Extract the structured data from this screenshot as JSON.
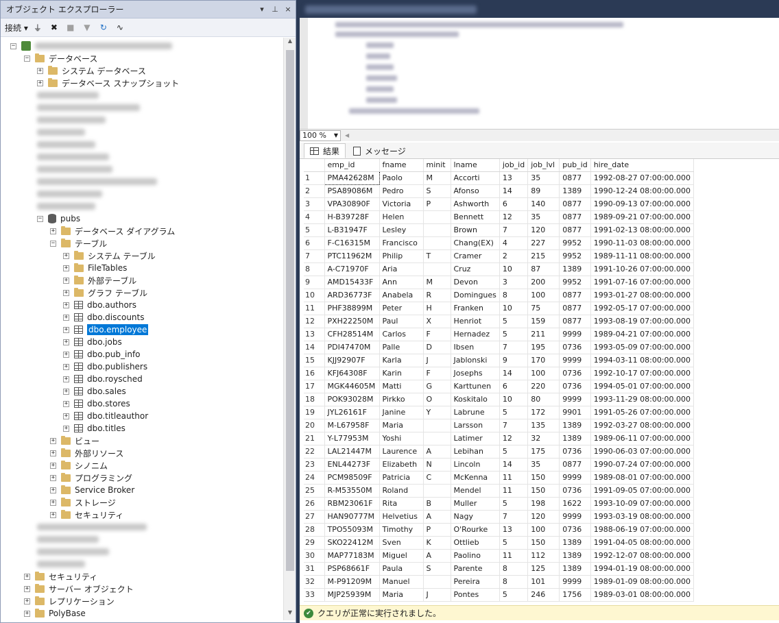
{
  "object_explorer": {
    "title": "オブジェクト エクスプローラー",
    "title_buttons": [
      "▾",
      "⊥",
      "×"
    ],
    "toolbar": {
      "connect": "接続 ▾"
    },
    "tree": [
      {
        "label": "データベース",
        "level": 1,
        "icon": "folder",
        "expander": "−"
      },
      {
        "label": "システム データベース",
        "level": 2,
        "icon": "folder",
        "expander": "+"
      },
      {
        "label": "データベース スナップショット",
        "level": 2,
        "icon": "folder",
        "expander": "+"
      },
      {
        "label": "pubs",
        "level": 2,
        "icon": "database",
        "expander": "−"
      },
      {
        "label": "データベース ダイアグラム",
        "level": 3,
        "icon": "folder",
        "expander": "+"
      },
      {
        "label": "テーブル",
        "level": 3,
        "icon": "folder",
        "expander": "−"
      },
      {
        "label": "システム テーブル",
        "level": 4,
        "icon": "folder",
        "expander": "+"
      },
      {
        "label": "FileTables",
        "level": 4,
        "icon": "folder",
        "expander": "+"
      },
      {
        "label": "外部テーブル",
        "level": 4,
        "icon": "folder",
        "expander": "+"
      },
      {
        "label": "グラフ テーブル",
        "level": 4,
        "icon": "folder",
        "expander": "+"
      },
      {
        "label": "dbo.authors",
        "level": 4,
        "icon": "table",
        "expander": "+"
      },
      {
        "label": "dbo.discounts",
        "level": 4,
        "icon": "table",
        "expander": "+"
      },
      {
        "label": "dbo.employee",
        "level": 4,
        "icon": "table",
        "expander": "+",
        "selected": true
      },
      {
        "label": "dbo.jobs",
        "level": 4,
        "icon": "table",
        "expander": "+"
      },
      {
        "label": "dbo.pub_info",
        "level": 4,
        "icon": "table",
        "expander": "+"
      },
      {
        "label": "dbo.publishers",
        "level": 4,
        "icon": "table",
        "expander": "+"
      },
      {
        "label": "dbo.roysched",
        "level": 4,
        "icon": "table",
        "expander": "+"
      },
      {
        "label": "dbo.sales",
        "level": 4,
        "icon": "table",
        "expander": "+"
      },
      {
        "label": "dbo.stores",
        "level": 4,
        "icon": "table",
        "expander": "+"
      },
      {
        "label": "dbo.titleauthor",
        "level": 4,
        "icon": "table",
        "expander": "+"
      },
      {
        "label": "dbo.titles",
        "level": 4,
        "icon": "table",
        "expander": "+"
      },
      {
        "label": "ビュー",
        "level": 3,
        "icon": "folder",
        "expander": "+"
      },
      {
        "label": "外部リソース",
        "level": 3,
        "icon": "folder",
        "expander": "+"
      },
      {
        "label": "シノニム",
        "level": 3,
        "icon": "folder",
        "expander": "+"
      },
      {
        "label": "プログラミング",
        "level": 3,
        "icon": "folder",
        "expander": "+"
      },
      {
        "label": "Service Broker",
        "level": 3,
        "icon": "folder",
        "expander": "+"
      },
      {
        "label": "ストレージ",
        "level": 3,
        "icon": "folder",
        "expander": "+"
      },
      {
        "label": "セキュリティ",
        "level": 3,
        "icon": "folder",
        "expander": "+"
      },
      {
        "label": "セキュリティ",
        "level": 1,
        "icon": "folder",
        "expander": "+"
      },
      {
        "label": "サーバー オブジェクト",
        "level": 1,
        "icon": "folder",
        "expander": "+"
      },
      {
        "label": "レプリケーション",
        "level": 1,
        "icon": "folder",
        "expander": "+"
      },
      {
        "label": "PolyBase",
        "level": 1,
        "icon": "folder",
        "expander": "+"
      }
    ]
  },
  "query": {
    "zoom": "100 %",
    "tabs": {
      "results": "結果",
      "messages": "メッセージ"
    },
    "status": "クエリが正常に実行されました。"
  },
  "results": {
    "columns": [
      "emp_id",
      "fname",
      "minit",
      "lname",
      "job_id",
      "job_lvl",
      "pub_id",
      "hire_date"
    ],
    "rows": [
      [
        "1",
        "PMA42628M",
        "Paolo",
        "M",
        "Accorti",
        "13",
        "35",
        "0877",
        "1992-08-27 07:00:00.000"
      ],
      [
        "2",
        "PSA89086M",
        "Pedro",
        "S",
        "Afonso",
        "14",
        "89",
        "1389",
        "1990-12-24 08:00:00.000"
      ],
      [
        "3",
        "VPA30890F",
        "Victoria",
        "P",
        "Ashworth",
        "6",
        "140",
        "0877",
        "1990-09-13 07:00:00.000"
      ],
      [
        "4",
        "H-B39728F",
        "Helen",
        "",
        "Bennett",
        "12",
        "35",
        "0877",
        "1989-09-21 07:00:00.000"
      ],
      [
        "5",
        "L-B31947F",
        "Lesley",
        "",
        "Brown",
        "7",
        "120",
        "0877",
        "1991-02-13 08:00:00.000"
      ],
      [
        "6",
        "F-C16315M",
        "Francisco",
        "",
        "Chang(EX)",
        "4",
        "227",
        "9952",
        "1990-11-03 08:00:00.000"
      ],
      [
        "7",
        "PTC11962M",
        "Philip",
        "T",
        "Cramer",
        "2",
        "215",
        "9952",
        "1989-11-11 08:00:00.000"
      ],
      [
        "8",
        "A-C71970F",
        "Aria",
        "",
        "Cruz",
        "10",
        "87",
        "1389",
        "1991-10-26 07:00:00.000"
      ],
      [
        "9",
        "AMD15433F",
        "Ann",
        "M",
        "Devon",
        "3",
        "200",
        "9952",
        "1991-07-16 07:00:00.000"
      ],
      [
        "10",
        "ARD36773F",
        "Anabela",
        "R",
        "Domingues",
        "8",
        "100",
        "0877",
        "1993-01-27 08:00:00.000"
      ],
      [
        "11",
        "PHF38899M",
        "Peter",
        "H",
        "Franken",
        "10",
        "75",
        "0877",
        "1992-05-17 07:00:00.000"
      ],
      [
        "12",
        "PXH22250M",
        "Paul",
        "X",
        "Henriot",
        "5",
        "159",
        "0877",
        "1993-08-19 07:00:00.000"
      ],
      [
        "13",
        "CFH28514M",
        "Carlos",
        "F",
        "Hernadez",
        "5",
        "211",
        "9999",
        "1989-04-21 07:00:00.000"
      ],
      [
        "14",
        "PDI47470M",
        "Palle",
        "D",
        "Ibsen",
        "7",
        "195",
        "0736",
        "1993-05-09 07:00:00.000"
      ],
      [
        "15",
        "KJJ92907F",
        "Karla",
        "J",
        "Jablonski",
        "9",
        "170",
        "9999",
        "1994-03-11 08:00:00.000"
      ],
      [
        "16",
        "KFJ64308F",
        "Karin",
        "F",
        "Josephs",
        "14",
        "100",
        "0736",
        "1992-10-17 07:00:00.000"
      ],
      [
        "17",
        "MGK44605M",
        "Matti",
        "G",
        "Karttunen",
        "6",
        "220",
        "0736",
        "1994-05-01 07:00:00.000"
      ],
      [
        "18",
        "POK93028M",
        "Pirkko",
        "O",
        "Koskitalo",
        "10",
        "80",
        "9999",
        "1993-11-29 08:00:00.000"
      ],
      [
        "19",
        "JYL26161F",
        "Janine",
        "Y",
        "Labrune",
        "5",
        "172",
        "9901",
        "1991-05-26 07:00:00.000"
      ],
      [
        "20",
        "M-L67958F",
        "Maria",
        "",
        "Larsson",
        "7",
        "135",
        "1389",
        "1992-03-27 08:00:00.000"
      ],
      [
        "21",
        "Y-L77953M",
        "Yoshi",
        "",
        "Latimer",
        "12",
        "32",
        "1389",
        "1989-06-11 07:00:00.000"
      ],
      [
        "22",
        "LAL21447M",
        "Laurence",
        "A",
        "Lebihan",
        "5",
        "175",
        "0736",
        "1990-06-03 07:00:00.000"
      ],
      [
        "23",
        "ENL44273F",
        "Elizabeth",
        "N",
        "Lincoln",
        "14",
        "35",
        "0877",
        "1990-07-24 07:00:00.000"
      ],
      [
        "24",
        "PCM98509F",
        "Patricia",
        "C",
        "McKenna",
        "11",
        "150",
        "9999",
        "1989-08-01 07:00:00.000"
      ],
      [
        "25",
        "R-M53550M",
        "Roland",
        "",
        "Mendel",
        "11",
        "150",
        "0736",
        "1991-09-05 07:00:00.000"
      ],
      [
        "26",
        "RBM23061F",
        "Rita",
        "B",
        "Muller",
        "5",
        "198",
        "1622",
        "1993-10-09 07:00:00.000"
      ],
      [
        "27",
        "HAN90777M",
        "Helvetius",
        "A",
        "Nagy",
        "7",
        "120",
        "9999",
        "1993-03-19 08:00:00.000"
      ],
      [
        "28",
        "TPO55093M",
        "Timothy",
        "P",
        "O'Rourke",
        "13",
        "100",
        "0736",
        "1988-06-19 07:00:00.000"
      ],
      [
        "29",
        "SKO22412M",
        "Sven",
        "K",
        "Ottlieb",
        "5",
        "150",
        "1389",
        "1991-04-05 08:00:00.000"
      ],
      [
        "30",
        "MAP77183M",
        "Miguel",
        "A",
        "Paolino",
        "11",
        "112",
        "1389",
        "1992-12-07 08:00:00.000"
      ],
      [
        "31",
        "PSP68661F",
        "Paula",
        "S",
        "Parente",
        "8",
        "125",
        "1389",
        "1994-01-19 08:00:00.000"
      ],
      [
        "32",
        "M-P91209M",
        "Manuel",
        "",
        "Pereira",
        "8",
        "101",
        "9999",
        "1989-01-09 08:00:00.000"
      ],
      [
        "33",
        "MJP25939M",
        "Maria",
        "J",
        "Pontes",
        "5",
        "246",
        "1756",
        "1989-03-01 08:00:00.000"
      ]
    ]
  }
}
